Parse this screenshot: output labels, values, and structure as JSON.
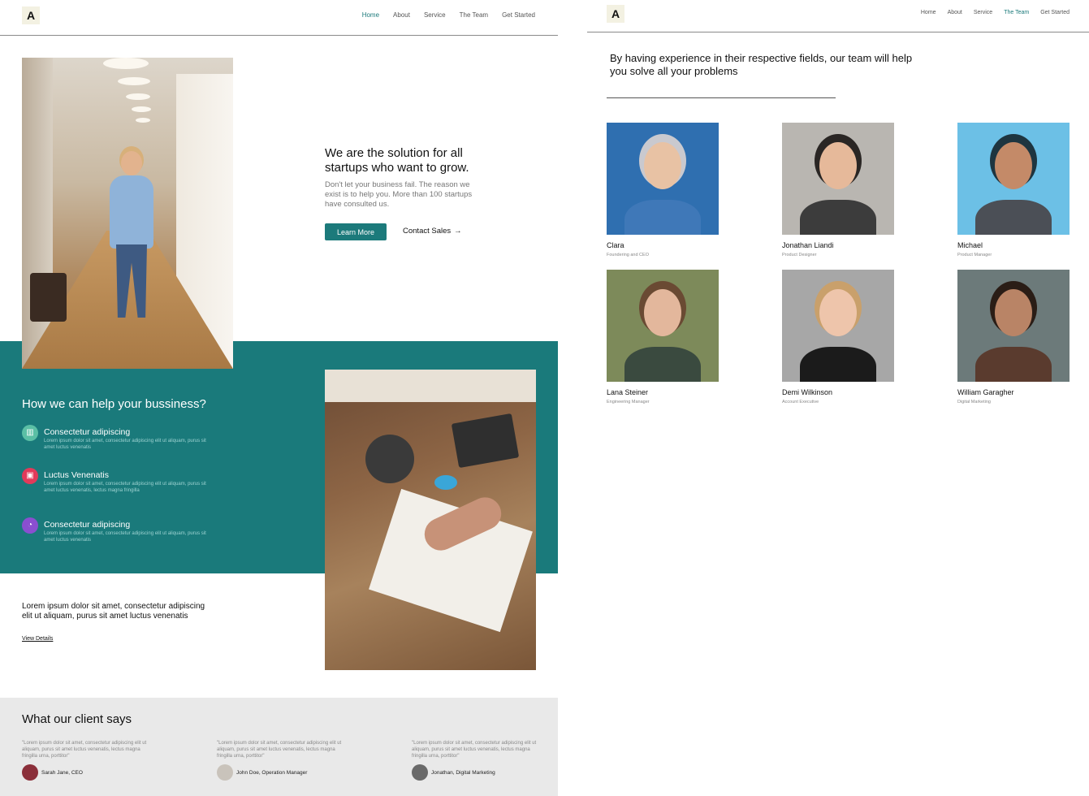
{
  "landing": {
    "logo": "A",
    "nav": [
      "Home",
      "About",
      "Service",
      "The Team",
      "Get Started"
    ],
    "hero": {
      "title": "We are the solution for all startups who want to grow.",
      "text": "Don't let your business fail. The reason we exist is to help you. More than 100 startups have consulted us.",
      "primary_button": "Learn More",
      "secondary_button": "Contact Sales",
      "secondary_arrow": "→"
    },
    "help": {
      "title": "How we can help your bussiness?",
      "features": [
        {
          "icon": "bar-chart-icon",
          "glyph": "▥",
          "color": "#5bbfa5",
          "title": "Consectetur adipiscing",
          "text": "Lorem ipsum dolor sit amet, consectetur adipiscing elit ut aliquam, purus sit amet luctus venenatis"
        },
        {
          "icon": "inbox-icon",
          "glyph": "▣",
          "color": "#e23a5a",
          "title": "Luctus Venenatis",
          "text": "Lorem ipsum dolor sit amet, consectetur adipiscing elit ut aliquam, purus sit amet luctus venenatis, lectus magna fringilla"
        },
        {
          "icon": "pie-chart-icon",
          "glyph": "◔",
          "color": "#8a4fd0",
          "title": "Consectetur adipiscing",
          "text": "Lorem ipsum dolor sit amet, consectetur adipiscing elit ut aliquam, purus sit amet luctus venenatis"
        }
      ]
    },
    "details": {
      "title": "Lorem ipsum dolor sit amet, consectetur adipiscing elit ut aliquam, purus sit amet luctus venenatis",
      "link": "View Details"
    },
    "testimonials": {
      "title": "What our client says",
      "items": [
        {
          "quote": "\"Lorem ipsum dolor sit amet, consectetur adipiscing elit ut aliquam, purus sit amet luctus venenatis, lectus magna fringilla urna, porttitor\"",
          "author": "Sarah Jane, CEO",
          "avatar_color": "#8b2f3a"
        },
        {
          "quote": "\"Lorem ipsum dolor sit amet, consectetur adipiscing elit ut aliquam, purus sit amet luctus venenatis, lectus magna fringilla urna, porttitor\"",
          "author": "John Doe, Operation Manager",
          "avatar_color": "#c9c3bb"
        },
        {
          "quote": "\"Lorem ipsum dolor sit amet, consectetur adipiscing elit ut aliquam, purus sit amet luctus venenatis, lectus magna fringilla urna, porttitor\"",
          "author": "Jonathan, Digital Marketing",
          "avatar_color": "#6a6a6a"
        }
      ]
    }
  },
  "team_page": {
    "logo": "A",
    "nav": [
      "Home",
      "About",
      "Service",
      "The Team",
      "Get Started"
    ],
    "active_nav": "The Team",
    "heading": "By having experience in their respective fields, our team will help you solve all your problems",
    "members": [
      {
        "name": "Clara",
        "role": "Foundering and CEO",
        "bg": "#2f6fb0",
        "skin": "#e8c2a4",
        "hair": "#c9c9cf",
        "shirt": "#3f78b8"
      },
      {
        "name": "Jonathan Liandi",
        "role": "Product Designer",
        "bg": "#b9b6b1",
        "skin": "#e6b99a",
        "hair": "#2a2624",
        "shirt": "#3c3c3c"
      },
      {
        "name": "Michael",
        "role": "Product Manager",
        "bg": "#6cc0e6",
        "skin": "#c48a68",
        "hair": "#1e3540",
        "shirt": "#4b4f56"
      },
      {
        "name": "Lana Steiner",
        "role": "Engineering Manager",
        "bg": "#7d8a5a",
        "skin": "#e3b79c",
        "hair": "#6a4a33",
        "shirt": "#3a4a3f"
      },
      {
        "name": "Demi Wilkinson",
        "role": "Account Executive",
        "bg": "#a7a7a7",
        "skin": "#eec5ab",
        "hair": "#c9a06b",
        "shirt": "#1b1b1b"
      },
      {
        "name": "William Garagher",
        "role": "Digital Marketing",
        "bg": "#6c7a7a",
        "skin": "#b98466",
        "hair": "#2a1d16",
        "shirt": "#5a3b2e"
      }
    ]
  }
}
